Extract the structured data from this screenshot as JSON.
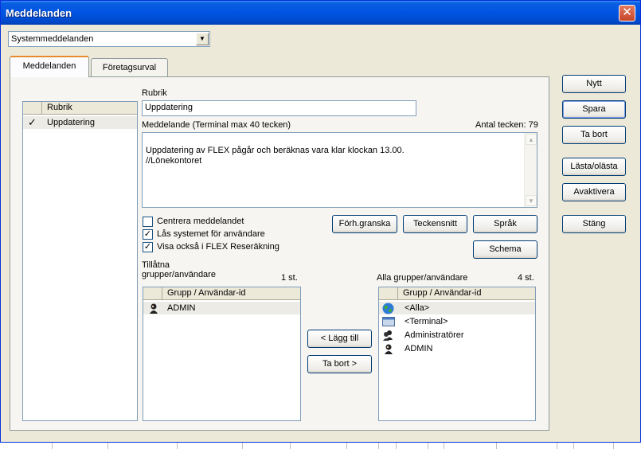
{
  "window": {
    "title": "Meddelanden"
  },
  "message_type": {
    "selected": "Systemmeddelanden"
  },
  "tabs": [
    {
      "label": "Meddelanden"
    },
    {
      "label": "Företagsurval"
    }
  ],
  "message_list": {
    "header": "Rubrik",
    "rows": [
      {
        "check": "✓",
        "label": "Uppdatering"
      }
    ]
  },
  "form": {
    "rubrik_label": "Rubrik",
    "rubrik_value": "Uppdatering",
    "message_label": "Meddelande (Terminal max 40 tecken)",
    "char_count": "Antal tecken: 79",
    "message_value": "Uppdatering av FLEX pågår och beräknas vara klar klockan 13.00.\n//Lönekontoret"
  },
  "options": [
    {
      "label": "Centrera meddelandet",
      "checked": false
    },
    {
      "label": "Lås systemet för användare",
      "checked": true
    },
    {
      "label": "Visa också i FLEX Reseräkning",
      "checked": true
    }
  ],
  "format_buttons": {
    "preview": "Förh.granska",
    "font": "Teckensnitt",
    "language": "Språk",
    "schedule": "Schema"
  },
  "allowed": {
    "label": "Tillåtna grupper/användare",
    "count": "1 st.",
    "header": "Grupp / Användar-id",
    "rows": [
      {
        "icon": "user-icon",
        "label": "ADMIN"
      }
    ]
  },
  "all": {
    "label": "Alla grupper/användare",
    "count": "4 st.",
    "header": "Grupp / Användar-id",
    "rows": [
      {
        "icon": "globe-icon",
        "label": "<Alla>"
      },
      {
        "icon": "terminal-icon",
        "label": "<Terminal>"
      },
      {
        "icon": "users-icon",
        "label": "Administratörer"
      },
      {
        "icon": "user-icon",
        "label": "ADMIN"
      }
    ]
  },
  "transfer": {
    "add": "< Lägg till",
    "remove": "Ta bort >"
  },
  "side_buttons": {
    "new": "Nytt",
    "save": "Spara",
    "delete": "Ta bort",
    "read_unread": "Lästa/olästa",
    "deactivate": "Avaktivera",
    "close": "Stäng"
  },
  "colors": {
    "title_bar": "#0054e3",
    "dialog_bg": "#ece9d8",
    "check_green": "#21a121"
  }
}
